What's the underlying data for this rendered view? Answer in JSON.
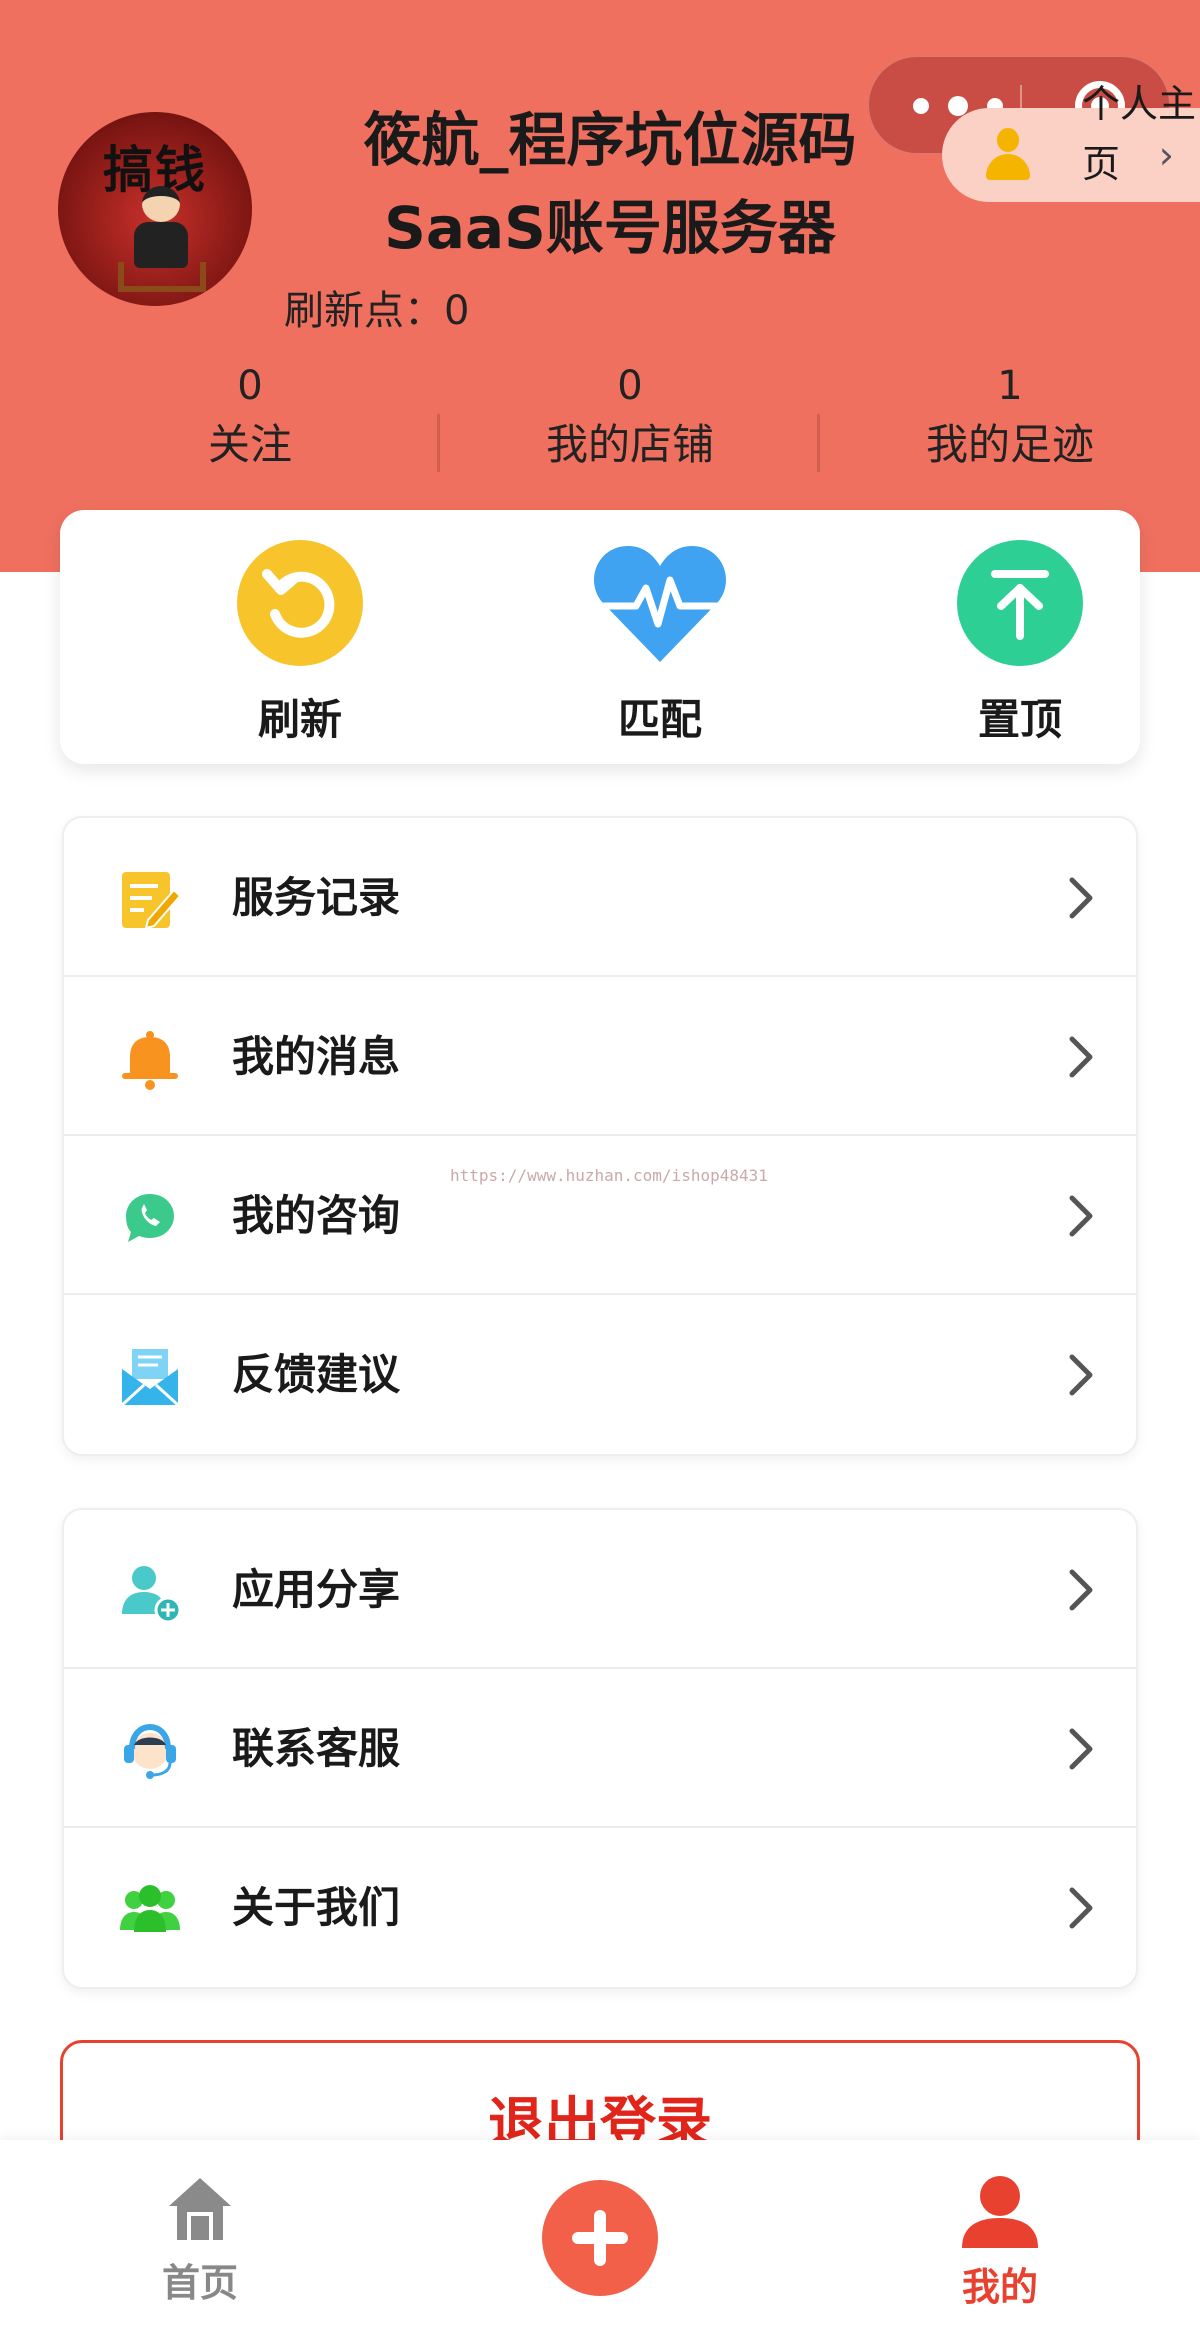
{
  "header": {
    "username": "筱航_程序坑位源码SaaS账号服务器",
    "refresh_points_label": "刷新点：0",
    "home_shortcut_label": "个人主页",
    "avatar_text": "搞钱",
    "bg_color": "#f07060"
  },
  "stats": [
    {
      "value": "0",
      "label": "关注"
    },
    {
      "value": "0",
      "label": "我的店铺"
    },
    {
      "value": "1",
      "label": "我的足迹"
    }
  ],
  "quick_actions": [
    {
      "label": "刷新",
      "icon": "refresh-icon",
      "color": "#f7c52b"
    },
    {
      "label": "匹配",
      "icon": "heartbeat-icon",
      "color": "#3fa3f2"
    },
    {
      "label": "置顶",
      "icon": "pin-top-icon",
      "color": "#2ecf95"
    }
  ],
  "menu_group_1": [
    {
      "label": "服务记录",
      "icon": "notepad-edit-icon"
    },
    {
      "label": "我的消息",
      "icon": "bell-icon"
    },
    {
      "label": "我的咨询",
      "icon": "chat-phone-icon"
    },
    {
      "label": "反馈建议",
      "icon": "envelope-icon"
    }
  ],
  "menu_group_2": [
    {
      "label": "应用分享",
      "icon": "user-add-icon"
    },
    {
      "label": "联系客服",
      "icon": "headset-agent-icon"
    },
    {
      "label": "关于我们",
      "icon": "group-icon"
    }
  ],
  "watermark": "https://www.huzhan.com/ishop48431",
  "logout_label": "退出登录",
  "tabbar": {
    "home_label": "首页",
    "mine_label": "我的",
    "active_color": "#e8412f",
    "inactive_color": "#888888"
  }
}
